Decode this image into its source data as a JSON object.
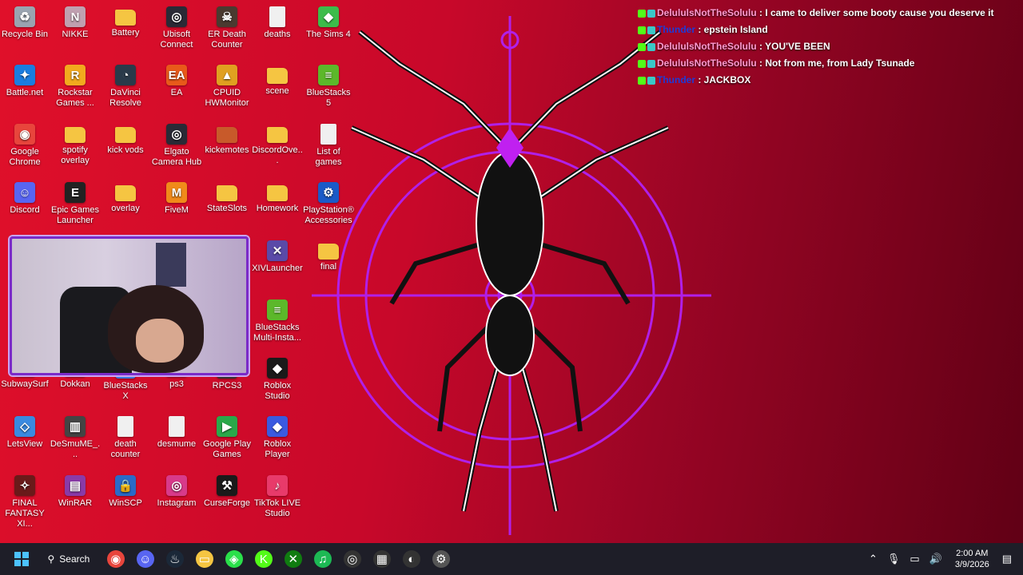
{
  "desktop_icons": [
    {
      "label": "Recycle Bin",
      "icon": "recycle-bin-icon",
      "color": "#9aa4b0",
      "glyph": "♻"
    },
    {
      "label": "NIKKE",
      "icon": "nikke-icon",
      "color": "#c0a0b0",
      "glyph": "N"
    },
    {
      "label": "Battery",
      "icon": "folder-icon",
      "color": "#f5c542",
      "glyph": ""
    },
    {
      "label": "Ubisoft Connect",
      "icon": "ubisoft-icon",
      "color": "#2a2a36",
      "glyph": "◎"
    },
    {
      "label": "ER Death Counter",
      "icon": "er-death-counter-icon",
      "color": "#4a3a30",
      "glyph": "☠"
    },
    {
      "label": "deaths",
      "icon": "text-file-icon",
      "color": "#f0f0f0",
      "glyph": ""
    },
    {
      "label": "The Sims 4",
      "icon": "sims-icon",
      "color": "#3cbc4a",
      "glyph": "◆"
    },
    {
      "label": "Battle.net",
      "icon": "battlenet-icon",
      "color": "#1a7de0",
      "glyph": "✦"
    },
    {
      "label": "Rockstar Games ...",
      "icon": "rockstar-icon",
      "color": "#f2a91e",
      "glyph": "R"
    },
    {
      "label": "DaVinci Resolve",
      "icon": "davinci-icon",
      "color": "#2a3a4a",
      "glyph": "◔"
    },
    {
      "label": "EA",
      "icon": "ea-icon",
      "color": "#e85a1a",
      "glyph": "EA"
    },
    {
      "label": "CPUID HWMonitor",
      "icon": "hwmonitor-icon",
      "color": "#e0a020",
      "glyph": "▲"
    },
    {
      "label": "scene",
      "icon": "folder-icon",
      "color": "#f5c542",
      "glyph": ""
    },
    {
      "label": "BlueStacks 5",
      "icon": "bluestacks-icon",
      "color": "#5cb82a",
      "glyph": "≡"
    },
    {
      "label": "Google Chrome",
      "icon": "chrome-icon",
      "color": "#e8453c",
      "glyph": "◉"
    },
    {
      "label": "spotify overlay",
      "icon": "folder-icon",
      "color": "#f5c542",
      "glyph": ""
    },
    {
      "label": "kick vods",
      "icon": "folder-icon",
      "color": "#f5c542",
      "glyph": ""
    },
    {
      "label": "Elgato Camera Hub",
      "icon": "elgato-icon",
      "color": "#2a2a36",
      "glyph": "◎"
    },
    {
      "label": "kickemotes",
      "icon": "folder-icon",
      "color": "#c85a2a",
      "glyph": ""
    },
    {
      "label": "DiscordOve...",
      "icon": "folder-icon",
      "color": "#f5c542",
      "glyph": ""
    },
    {
      "label": "List of games",
      "icon": "text-file-icon",
      "color": "#f0f0f0",
      "glyph": ""
    },
    {
      "label": "Discord",
      "icon": "discord-icon",
      "color": "#5865f2",
      "glyph": "☺"
    },
    {
      "label": "Epic Games Launcher",
      "icon": "epic-games-icon",
      "color": "#222",
      "glyph": "E"
    },
    {
      "label": "overlay",
      "icon": "folder-icon",
      "color": "#f5c542",
      "glyph": ""
    },
    {
      "label": "FiveM",
      "icon": "fivem-icon",
      "color": "#f08a1a",
      "glyph": "M"
    },
    {
      "label": "StateSlots",
      "icon": "folder-icon",
      "color": "#f5c542",
      "glyph": ""
    },
    {
      "label": "Homework",
      "icon": "folder-icon",
      "color": "#f5c542",
      "glyph": ""
    },
    {
      "label": "PlayStation® Accessories",
      "icon": "playstation-icon",
      "color": "#1a5ac8",
      "glyph": "⚙"
    },
    {
      "label": "XIVLauncher",
      "icon": "xivlauncher-icon",
      "color": "#5a4aa8",
      "glyph": "✕"
    },
    {
      "label": "final",
      "icon": "folder-icon",
      "color": "#f5c542",
      "glyph": ""
    },
    {
      "label": "BlueStacks Multi-Insta...",
      "icon": "bluestacks-icon",
      "color": "#5cb82a",
      "glyph": "≡"
    },
    {
      "label": "SubwaySurf",
      "icon": "folder-icon",
      "color": "#f5c542",
      "glyph": ""
    },
    {
      "label": "Dokkan",
      "icon": "folder-icon",
      "color": "#f5c542",
      "glyph": ""
    },
    {
      "label": "BlueStacks X",
      "icon": "bluestacks-icon",
      "color": "#3a7ae0",
      "glyph": "X"
    },
    {
      "label": "ps3",
      "icon": "folder-icon",
      "color": "#f5c542",
      "glyph": ""
    },
    {
      "label": "RPCS3",
      "icon": "rpcs3-icon",
      "color": "#333",
      "glyph": "▣"
    },
    {
      "label": "Roblox Studio",
      "icon": "roblox-studio-icon",
      "color": "#1a1a1a",
      "glyph": "◆"
    },
    {
      "label": "LetsView",
      "icon": "letsview-icon",
      "color": "#3a8ae0",
      "glyph": "◇"
    },
    {
      "label": "DeSmuME_...",
      "icon": "desmume-icon",
      "color": "#444",
      "glyph": "▥"
    },
    {
      "label": "death counter",
      "icon": "text-file-icon",
      "color": "#f0f0f0",
      "glyph": ""
    },
    {
      "label": "desmume",
      "icon": "text-file-icon",
      "color": "#f0f0f0",
      "glyph": ""
    },
    {
      "label": "Google Play Games",
      "icon": "google-play-icon",
      "color": "#2aa84a",
      "glyph": "▶"
    },
    {
      "label": "Roblox Player",
      "icon": "roblox-icon",
      "color": "#3a5ae0",
      "glyph": "◆"
    },
    {
      "label": "FINAL FANTASY XI...",
      "icon": "final-fantasy-icon",
      "color": "#6a1a1a",
      "glyph": "✧"
    },
    {
      "label": "WinRAR",
      "icon": "winrar-icon",
      "color": "#8a3aa8",
      "glyph": "▤"
    },
    {
      "label": "WinSCP",
      "icon": "winscp-icon",
      "color": "#2a6ac8",
      "glyph": "🔒"
    },
    {
      "label": "Instagram",
      "icon": "instagram-icon",
      "color": "#d83a8a",
      "glyph": "◎"
    },
    {
      "label": "CurseForge",
      "icon": "curseforge-icon",
      "color": "#1a1a1a",
      "glyph": "⚒"
    },
    {
      "label": "TikTok LIVE Studio",
      "icon": "tiktok-icon",
      "color": "#e83a6a",
      "glyph": "♪"
    }
  ],
  "chat": [
    {
      "user": "DelululsNotTheSolulu",
      "sep": " : ",
      "message": "I came to deliver some booty cause you deserve it",
      "user_color": "pink"
    },
    {
      "user": "Thunder",
      "sep": " : ",
      "message": "epstein Island",
      "user_color": "blue"
    },
    {
      "user": "DelululsNotTheSolulu",
      "sep": " : ",
      "message": "YOU'VE BEEN",
      "user_color": "pink"
    },
    {
      "user": "DelululsNotTheSolulu",
      "sep": " : ",
      "message": "Not from me, from Lady Tsunade",
      "user_color": "pink"
    },
    {
      "user": "Thunder",
      "sep": " : ",
      "message": "JACKBOX",
      "user_color": "blue"
    }
  ],
  "taskbar": {
    "search_label": "Search",
    "pinned": [
      {
        "name": "chrome-taskbar-icon",
        "glyph": "◉",
        "color": "#e8453c"
      },
      {
        "name": "discord-taskbar-icon",
        "glyph": "☺",
        "color": "#5865f2"
      },
      {
        "name": "steam-taskbar-icon",
        "glyph": "♨",
        "color": "#1b2838"
      },
      {
        "name": "file-explorer-taskbar-icon",
        "glyph": "▭",
        "color": "#f5c542"
      },
      {
        "name": "razer-taskbar-icon",
        "glyph": "◈",
        "color": "#2ae04a"
      },
      {
        "name": "kick-taskbar-icon",
        "glyph": "K",
        "color": "#53fc18"
      },
      {
        "name": "xbox-taskbar-icon",
        "glyph": "✕",
        "color": "#107c10"
      },
      {
        "name": "spotify-taskbar-icon",
        "glyph": "♫",
        "color": "#1db954"
      },
      {
        "name": "elgato-taskbar-icon",
        "glyph": "◎",
        "color": "#333"
      },
      {
        "name": "streamdeck-taskbar-icon",
        "glyph": "▦",
        "color": "#333"
      },
      {
        "name": "obs-taskbar-icon",
        "glyph": "◐",
        "color": "#333"
      },
      {
        "name": "settings-taskbar-icon",
        "glyph": "⚙",
        "color": "#555"
      }
    ],
    "clock_time": "2:00 AM",
    "clock_date": "3/9/2026"
  }
}
